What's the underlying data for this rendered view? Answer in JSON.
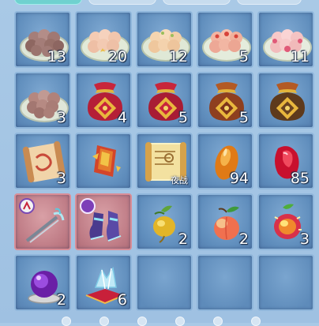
{
  "tabs": [
    "tab-1",
    "tab-2",
    "tab-3",
    "tab-4"
  ],
  "colors": {
    "slot_bg": "#5f8dbc",
    "slot_border": "#8fb6db",
    "highlight_bg": "#bf7c86",
    "highlight_border": "#d98d96",
    "active_tab": "#6fd1cf"
  },
  "inventory": {
    "slots": [
      {
        "icon": "dumpling-plate-icon",
        "count": "13"
      },
      {
        "icon": "dumpling-plate-icon",
        "count": "20"
      },
      {
        "icon": "dumpling-plate-icon",
        "count": "12"
      },
      {
        "icon": "dumpling-plate-icon",
        "count": "5"
      },
      {
        "icon": "dumpling-plate-icon",
        "count": "11"
      },
      {
        "icon": "dumpling-plate-icon",
        "count": "3"
      },
      {
        "icon": "lucky-bag-icon",
        "count": "4"
      },
      {
        "icon": "lucky-bag-icon",
        "count": "5"
      },
      {
        "icon": "lucky-bag-icon",
        "count": "5"
      },
      {
        "icon": "lucky-bag-icon",
        "count": ""
      },
      {
        "icon": "scroll-icon",
        "count": "3"
      },
      {
        "icon": "talisman-icon",
        "count": ""
      },
      {
        "icon": "map-scroll-icon",
        "count": "",
        "tag": "夜战"
      },
      {
        "icon": "orange-gem-icon",
        "count": "94"
      },
      {
        "icon": "red-gem-icon",
        "count": "85"
      },
      {
        "icon": "weapon-scroll-icon",
        "count": "",
        "highlight": true
      },
      {
        "icon": "armor-boots-icon",
        "count": "",
        "highlight": true
      },
      {
        "icon": "golden-fruit-icon",
        "count": "2"
      },
      {
        "icon": "peach-icon",
        "count": "2"
      },
      {
        "icon": "glowing-fruit-icon",
        "count": "3"
      },
      {
        "icon": "purple-orb-icon",
        "count": "2"
      },
      {
        "icon": "crystal-cushion-icon",
        "count": "6"
      },
      {
        "icon": "empty-slot",
        "count": ""
      },
      {
        "icon": "empty-slot",
        "count": ""
      },
      {
        "icon": "empty-slot",
        "count": ""
      }
    ]
  },
  "pager": {
    "pages": 6,
    "active": 0
  }
}
